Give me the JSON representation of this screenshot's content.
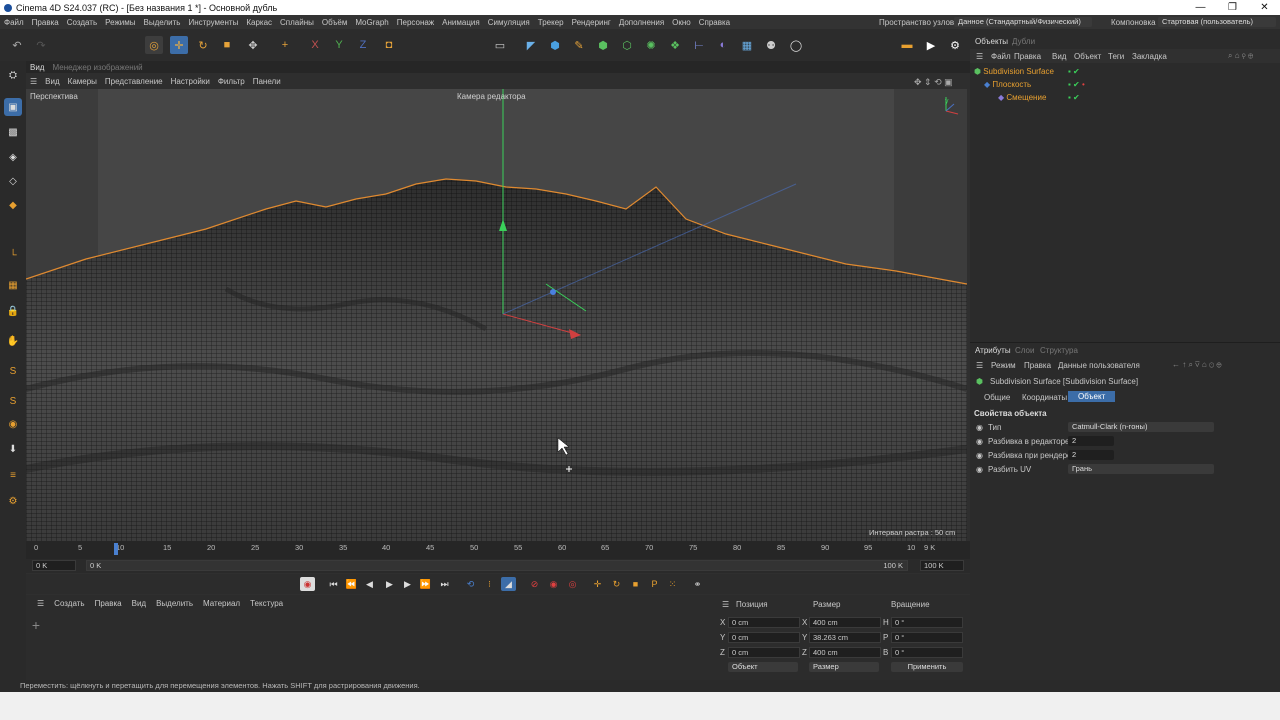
{
  "window": {
    "title": "Cinema 4D S24.037 (RC) - [Без названия 1 *] - Основной дубль"
  },
  "menu": [
    "Файл",
    "Правка",
    "Создать",
    "Режимы",
    "Выделить",
    "Инструменты",
    "Каркас",
    "Сплайны",
    "Объём",
    "MoGraph",
    "Персонаж",
    "Анимация",
    "Симуляция",
    "Трекер",
    "Рендеринг",
    "Дополнения",
    "Окно",
    "Справка"
  ],
  "menu_right": {
    "node_space_label": "Пространство узлов:",
    "node_space_value": "Данное (Стандартный/Физический)",
    "layout_label": "Компоновка",
    "layout_value": "Стартовая (пользователь)"
  },
  "left_tabs": {
    "view": "Вид",
    "image_manager": "Менеджер изображений"
  },
  "viewport_menu": [
    "Вид",
    "Камеры",
    "Представление",
    "Настройки",
    "Фильтр",
    "Панели"
  ],
  "viewport": {
    "projection": "Перспектива",
    "camera": "Камера редактора",
    "grid_info": "Интервал растра : 50 cm"
  },
  "timeline": {
    "ticks": [
      "0",
      "5",
      "10",
      "15",
      "20",
      "25",
      "30",
      "35",
      "40",
      "45",
      "50",
      "55",
      "60",
      "65",
      "70",
      "75",
      "80",
      "85",
      "90",
      "95",
      "10"
    ],
    "end": "9 K",
    "start_field": "0 K",
    "range_start": "0 K",
    "range_end": "100 K",
    "max_field": "100 K"
  },
  "material_menu": [
    "Создать",
    "Правка",
    "Вид",
    "Выделить",
    "Материал",
    "Текстура"
  ],
  "coords": {
    "headers": [
      "Позиция",
      "Размер",
      "Вращение"
    ],
    "rows": [
      {
        "axis": "X",
        "pos": "0 cm",
        "size_axis": "X",
        "size": "400 cm",
        "rot_axis": "H",
        "rot": "0 °"
      },
      {
        "axis": "Y",
        "pos": "0 cm",
        "size_axis": "Y",
        "size": "38.263 cm",
        "rot_axis": "P",
        "rot": "0 °"
      },
      {
        "axis": "Z",
        "pos": "0 cm",
        "size_axis": "Z",
        "size": "400 cm",
        "rot_axis": "B",
        "rot": "0 °"
      }
    ],
    "mode": "Объект",
    "size_mode": "Размер",
    "apply": "Применить"
  },
  "objects_panel": {
    "tabs": [
      "Объекты",
      "Дубли"
    ],
    "menu": [
      "Файл",
      "Правка",
      "Вид",
      "Объект",
      "Теги",
      "Закладка"
    ],
    "items": [
      "Subdivision Surface",
      "Плоскость",
      "Смещение"
    ]
  },
  "attributes": {
    "tabs": [
      "Атрибуты",
      "Слои",
      "Структура"
    ],
    "menu": [
      "Режим",
      "Правка",
      "Данные пользователя"
    ],
    "object_name": "Subdivision Surface [Subdivision Surface]",
    "subtabs": [
      "Общие",
      "Координаты",
      "Объект"
    ],
    "section": "Свойства объекта",
    "props": [
      {
        "label": "Тип",
        "value": "Catmull-Clark (n-гоны)"
      },
      {
        "label": "Разбивка в редакторе",
        "value": "2"
      },
      {
        "label": "Разбивка при рендере",
        "value": "2"
      },
      {
        "label": "Разбить UV",
        "value": "Грань"
      }
    ]
  },
  "status": "Переместить: щёлкнуть и перетащить для перемещения элементов. Нажать SHIFT для растрирования движения."
}
